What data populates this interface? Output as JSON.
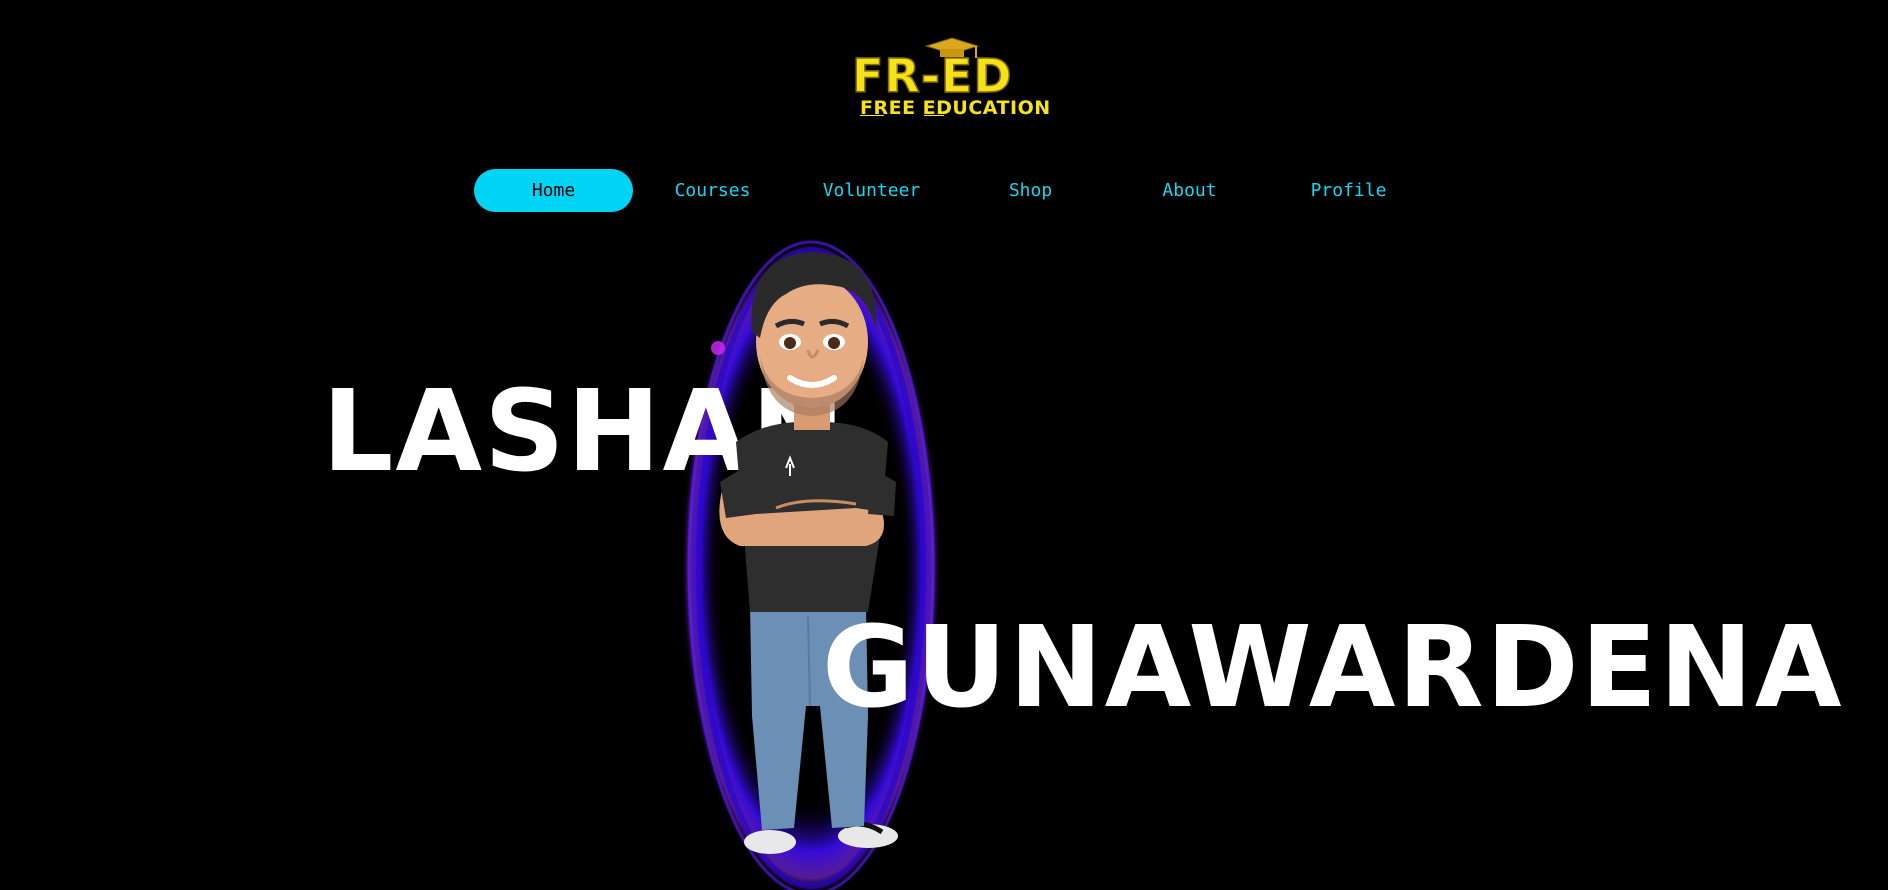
{
  "logo": {
    "main": "FR-ED",
    "sub": "FREE EDUCATION"
  },
  "nav": {
    "items": [
      {
        "label": "Home",
        "active": true
      },
      {
        "label": "Courses",
        "active": false
      },
      {
        "label": "Volunteer",
        "active": false
      },
      {
        "label": "Shop",
        "active": false
      },
      {
        "label": "About",
        "active": false
      },
      {
        "label": "Profile",
        "active": false
      }
    ]
  },
  "hero": {
    "first_name": "LASHAN",
    "last_name": "GUNAWARDENA"
  },
  "colors": {
    "background": "#000000",
    "accent": "#00d4f5",
    "logo": "#f5e21a",
    "text": "#ffffff",
    "portal": "#4a10ff"
  }
}
